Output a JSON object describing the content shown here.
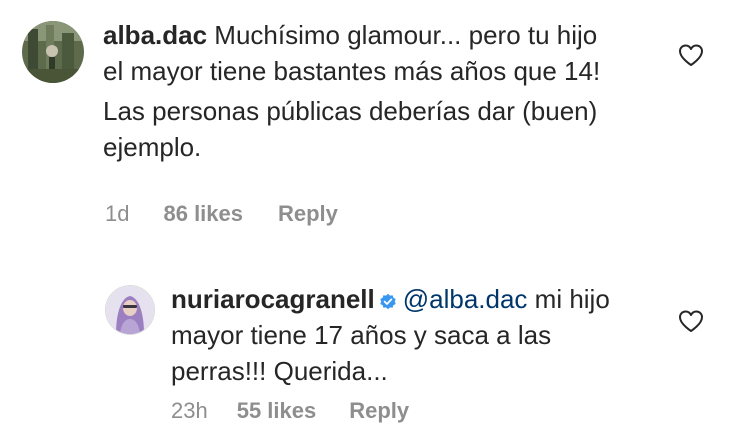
{
  "comment": {
    "username": "alba.dac",
    "text_line1": "Muchísimo glamour... pero tu hijo el mayor tiene bastantes más años que 14!",
    "text_line2": "Las personas públicas deberías dar (buen) ejemplo.",
    "time": "1d",
    "likes": "86 likes",
    "reply": "Reply",
    "avatar_icon": "avatar-photo",
    "like_icon": "heart-outline-icon"
  },
  "reply_comment": {
    "username": "nuriarocagranell",
    "verified_icon": "verified-badge-icon",
    "mention": "@alba.dac",
    "text": " mi hijo mayor tiene 17 años y saca a las perras!!! Querida...",
    "time": "23h",
    "likes": "55 likes",
    "reply": "Reply",
    "avatar_icon": "avatar-photo",
    "like_icon": "heart-outline-icon"
  },
  "colors": {
    "text": "#262626",
    "secondary": "#8e8e8e",
    "mention": "#00376b",
    "verified": "#3897f0"
  }
}
